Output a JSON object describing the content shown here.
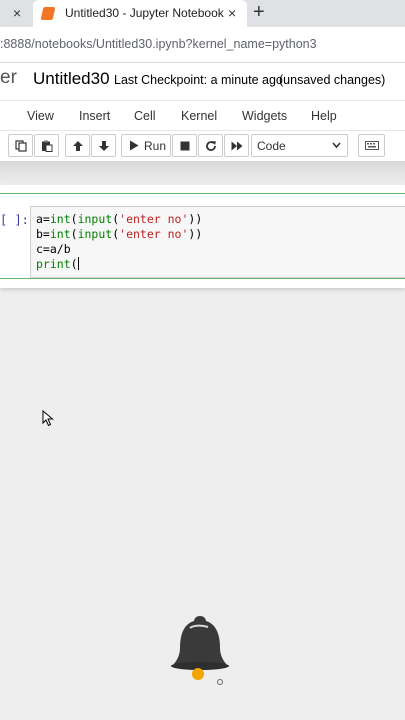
{
  "browser": {
    "prev_tab_close": "×",
    "active_tab_title": "Untitled30 - Jupyter Notebook",
    "active_tab_close": "×",
    "new_tab": "+",
    "url": ":8888/notebooks/Untitled30.ipynb?kernel_name=python3"
  },
  "header": {
    "logo_text": "er",
    "notebook_name": "Untitled30",
    "checkpoint": "Last Checkpoint: a minute ago",
    "unsaved": "(unsaved changes)"
  },
  "menubar": {
    "view": "View",
    "insert": "Insert",
    "cell": "Cell",
    "kernel": "Kernel",
    "widgets": "Widgets",
    "help": "Help"
  },
  "toolbar": {
    "run_label": "Run",
    "cell_type": "Code",
    "icons": [
      "copy-icon",
      "paste-icon",
      "move-up-icon",
      "move-down-icon",
      "run-icon",
      "stop-icon",
      "restart-icon",
      "fast-forward-icon",
      "keyboard-icon"
    ]
  },
  "cell": {
    "prompt": "[ ]:",
    "lines": [
      {
        "a": "a=",
        "b": "int",
        "c": "(",
        "d": "input",
        "e": "(",
        "f": "'enter no'",
        "g": "))"
      },
      {
        "a": "b=",
        "b": "int",
        "c": "(",
        "d": "input",
        "e": "(",
        "f": "'enter no'",
        "g": "))"
      },
      {
        "a": "c=a/b"
      },
      {
        "a": "print",
        "b": "("
      }
    ]
  },
  "colors": {
    "accent_green": "#66bb6a",
    "prompt_blue": "#303f9f",
    "keyword_green": "#008000",
    "string_red": "#ba2121",
    "jupyter_orange": "#f37626"
  }
}
